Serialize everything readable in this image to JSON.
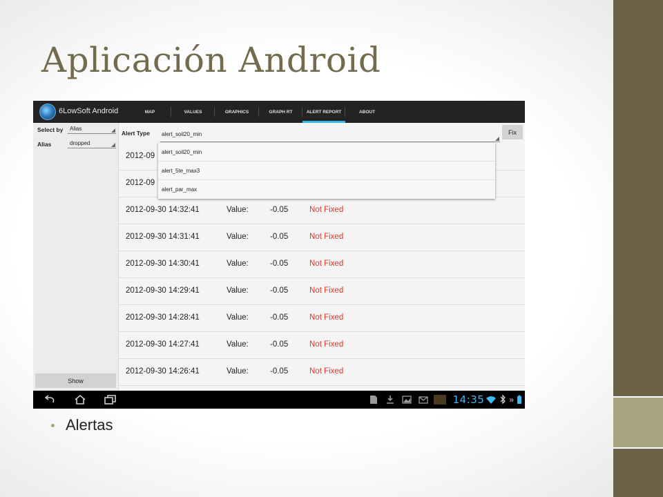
{
  "slide": {
    "title": "Aplicación Android",
    "bullet": "Alertas"
  },
  "app": {
    "name": "6LowSoft Android",
    "tabs": [
      "MAP",
      "VALUES",
      "GRAPHICS",
      "GRAPH RT",
      "ALERT REPORT",
      "ABOUT"
    ],
    "active_tab": "ALERT REPORT"
  },
  "left_panel": {
    "select_by_label": "Select by",
    "select_by_value": "Alias",
    "alias_label": "Alias",
    "alias_value": "dropped",
    "show_button": "Show"
  },
  "alert_type": {
    "label": "Alert Type",
    "value": "alert_soil20_min",
    "fix_button": "Fix",
    "options": [
      "alert_soil20_min",
      "alert_5te_max3",
      "alert_par_max"
    ]
  },
  "rows": [
    {
      "date": "2012-09",
      "value_label": "",
      "value": "",
      "status": ""
    },
    {
      "date": "2012-09",
      "value_label": "",
      "value": "",
      "status": ""
    },
    {
      "date": "2012-09-30 14:32:41",
      "value_label": "Value:",
      "value": "-0.05",
      "status": "Not Fixed"
    },
    {
      "date": "2012-09-30 14:31:41",
      "value_label": "Value:",
      "value": "-0.05",
      "status": "Not Fixed"
    },
    {
      "date": "2012-09-30 14:30:41",
      "value_label": "Value:",
      "value": "-0.05",
      "status": "Not Fixed"
    },
    {
      "date": "2012-09-30 14:29:41",
      "value_label": "Value:",
      "value": "-0.05",
      "status": "Not Fixed"
    },
    {
      "date": "2012-09-30 14:28:41",
      "value_label": "Value:",
      "value": "-0.05",
      "status": "Not Fixed"
    },
    {
      "date": "2012-09-30 14:27:41",
      "value_label": "Value:",
      "value": "-0.05",
      "status": "Not Fixed"
    },
    {
      "date": "2012-09-30 14:26:41",
      "value_label": "Value:",
      "value": "-0.05",
      "status": "Not Fixed"
    }
  ],
  "navbar": {
    "clock": "14:35",
    "icons": [
      "back-icon",
      "home-icon",
      "recent-apps-icon",
      "file-icon",
      "download-icon",
      "image-icon",
      "mail-icon",
      "app-thumbnail-icon",
      "wifi-icon",
      "bluetooth-icon",
      "chevron-icon",
      "battery-icon"
    ]
  },
  "colors": {
    "title": "#736b4e",
    "status_not_fixed": "#e53222",
    "accent": "#33b5e5",
    "side_dark": "#6b6248",
    "side_light": "#a9a37f"
  }
}
